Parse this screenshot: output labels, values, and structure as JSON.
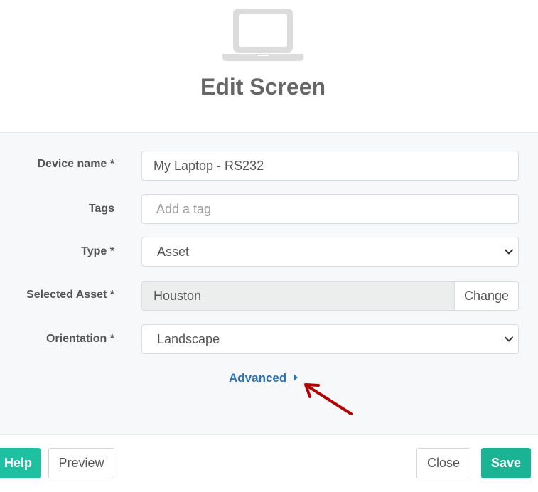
{
  "header": {
    "title": "Edit Screen"
  },
  "form": {
    "device_name": {
      "label": "Device name *",
      "value": "My Laptop - RS232"
    },
    "tags": {
      "label": "Tags",
      "placeholder": "Add a tag"
    },
    "type": {
      "label": "Type *",
      "selected": "Asset"
    },
    "selected_asset": {
      "label": "Selected Asset *",
      "value": "Houston",
      "change_label": "Change"
    },
    "orientation": {
      "label": "Orientation *",
      "selected": "Landscape"
    },
    "advanced_label": "Advanced"
  },
  "footer": {
    "help_label": "Help",
    "preview_label": "Preview",
    "close_label": "Close",
    "save_label": "Save"
  },
  "icons": {
    "header_icon": "laptop-icon",
    "select_icon": "chevron-down-icon",
    "advanced_icon": "caret-right-icon",
    "annotation_icon": "red-arrow-icon"
  },
  "colors": {
    "accent_teal": "#1ab394",
    "help_teal": "#1dc1a2",
    "link_blue": "#2d72b5",
    "annotation_red": "#b00000",
    "panel_bg": "#f7f8fa",
    "disabled_field_bg": "#eceded"
  }
}
